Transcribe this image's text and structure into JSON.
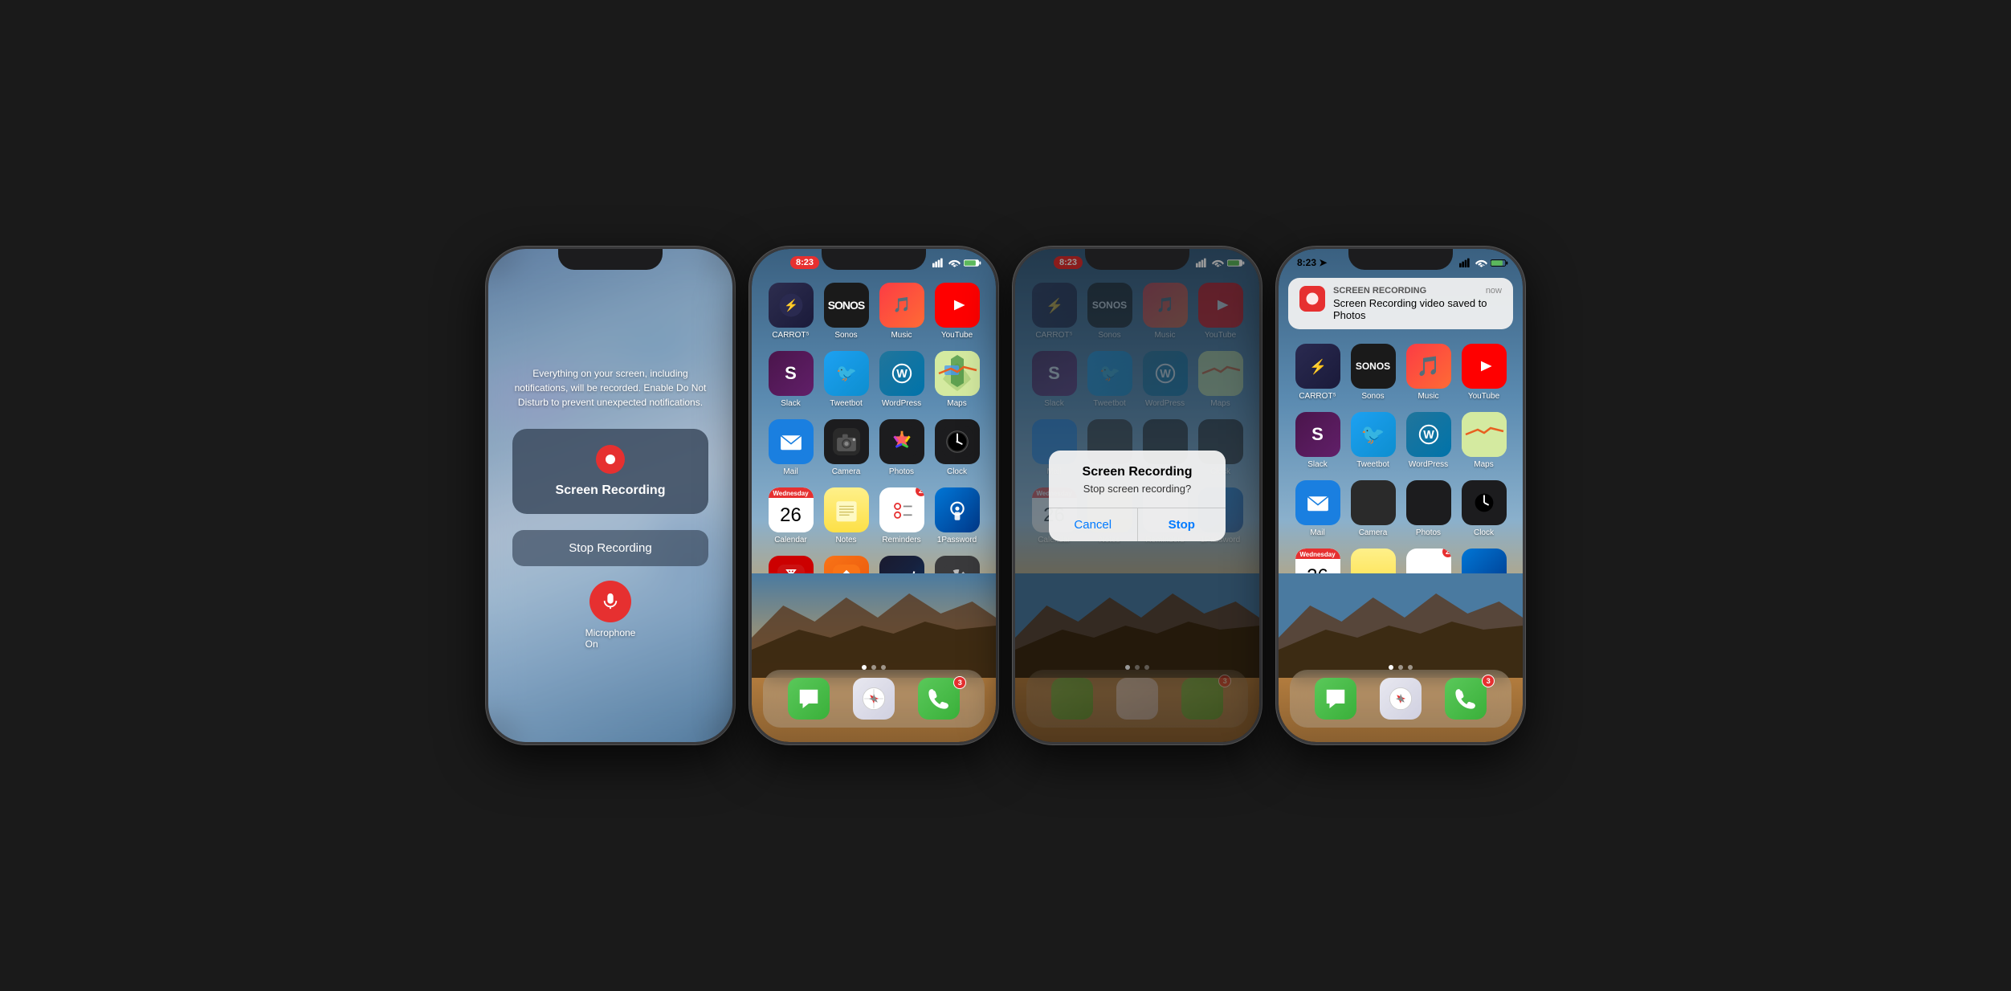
{
  "phones": [
    {
      "id": "phone1",
      "type": "recording",
      "time": "",
      "warning_text": "Everything on your screen, including notifications, will be recorded. Enable Do Not Disturb to prevent unexpected notifications.",
      "main_label": "Screen Recording",
      "stop_label": "Stop Recording",
      "mic_label": "Microphone\nOn"
    },
    {
      "id": "phone2",
      "type": "home",
      "time": "8:23",
      "apps": [
        {
          "name": "CARROT⁵",
          "icon": "carrot",
          "row": 0
        },
        {
          "name": "Sonos",
          "icon": "sonos",
          "row": 0
        },
        {
          "name": "Music",
          "icon": "music",
          "row": 0
        },
        {
          "name": "YouTube",
          "icon": "youtube",
          "row": 0
        },
        {
          "name": "Slack",
          "icon": "slack",
          "row": 1
        },
        {
          "name": "Tweetbot",
          "icon": "tweetbot",
          "row": 1
        },
        {
          "name": "WordPress",
          "icon": "wordpress",
          "row": 1
        },
        {
          "name": "Maps",
          "icon": "maps",
          "row": 1
        },
        {
          "name": "Mail",
          "icon": "mail",
          "row": 2
        },
        {
          "name": "Camera",
          "icon": "camera",
          "row": 2
        },
        {
          "name": "Photos",
          "icon": "photos",
          "row": 2
        },
        {
          "name": "Clock",
          "icon": "clock",
          "row": 2
        },
        {
          "name": "Calendar",
          "icon": "calendar",
          "row": 3
        },
        {
          "name": "Notes",
          "icon": "notes",
          "row": 3
        },
        {
          "name": "Reminders",
          "icon": "reminders",
          "row": 3,
          "badge": "2"
        },
        {
          "name": "1Password",
          "icon": "1password",
          "row": 3
        },
        {
          "name": "Tesla",
          "icon": "tesla",
          "row": 4
        },
        {
          "name": "Home",
          "icon": "home",
          "row": 4
        },
        {
          "name": "Slopes",
          "icon": "slopes",
          "row": 4
        },
        {
          "name": "Settings",
          "icon": "settings",
          "row": 4
        }
      ],
      "dock": [
        "Messages",
        "Safari",
        "Phone"
      ],
      "phone_badge": "3"
    },
    {
      "id": "phone3",
      "type": "home-dialog",
      "time": "8:23",
      "dialog_title": "Screen Recording",
      "dialog_message": "Stop screen recording?",
      "dialog_cancel": "Cancel",
      "dialog_stop": "Stop",
      "phone_badge": "3"
    },
    {
      "id": "phone4",
      "type": "home-notification",
      "time": "8:23",
      "notif_app": "SCREEN RECORDING",
      "notif_time": "now",
      "notif_message": "Screen Recording video saved to Photos",
      "phone_badge": "3"
    }
  ],
  "icons": {
    "record_dot": "⏺",
    "mic": "🎤",
    "messages": "💬",
    "safari": "🧭",
    "phone": "📞"
  }
}
